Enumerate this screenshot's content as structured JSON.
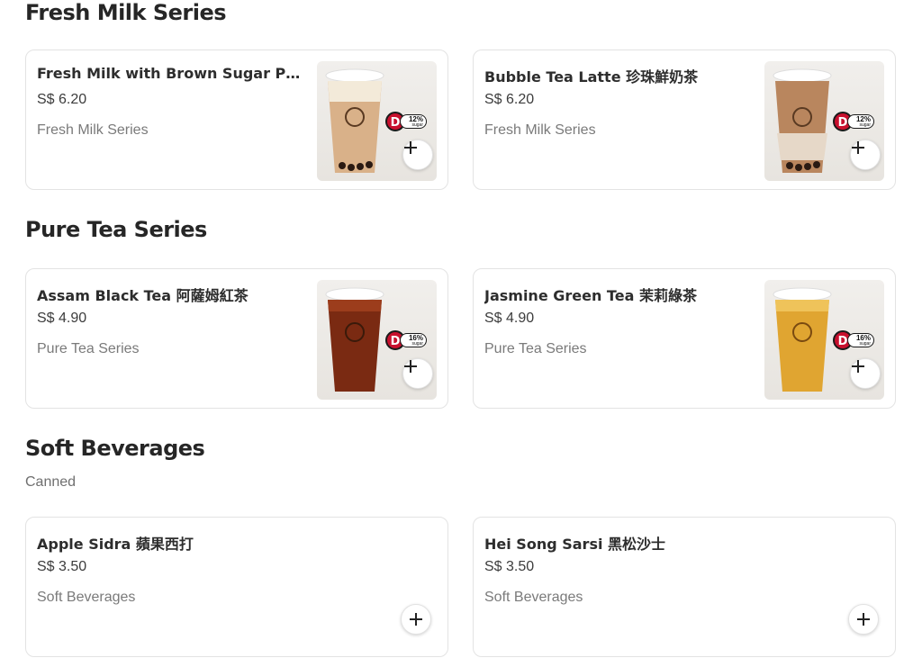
{
  "sections": [
    {
      "title": "Fresh Milk Series",
      "items": [
        {
          "name": "Fresh Milk with Brown Sugar Pearl ...",
          "price": "S$ 6.20",
          "category": "Fresh Milk Series",
          "sugar": "12%",
          "sugar_unit": "sugar",
          "grade": "D",
          "drink_color": "#d9b189",
          "top_color": "#f3ead9"
        },
        {
          "name": "Bubble Tea Latte 珍珠鮮奶茶",
          "price": "S$ 6.20",
          "category": "Fresh Milk Series",
          "sugar": "12%",
          "sugar_unit": "sugar",
          "grade": "D",
          "drink_color": "#b9865e",
          "top_color": "#e6d8c8"
        }
      ]
    },
    {
      "title": "Pure Tea Series",
      "items": [
        {
          "name": "Assam Black Tea 阿薩姆紅茶",
          "price": "S$ 4.90",
          "category": "Pure Tea Series",
          "sugar": "16%",
          "sugar_unit": "sugar",
          "grade": "D",
          "drink_color": "#7a2a12",
          "top_color": "#9c3d1c"
        },
        {
          "name": "Jasmine Green Tea 茉莉綠茶",
          "price": "S$ 4.90",
          "category": "Pure Tea Series",
          "sugar": "16%",
          "sugar_unit": "sugar",
          "grade": "D",
          "drink_color": "#e0a531",
          "top_color": "#efc35a"
        }
      ]
    },
    {
      "title": "Soft Beverages",
      "subtitle": "Canned",
      "items": [
        {
          "name": "Apple Sidra 蘋果西打",
          "price": "S$ 3.50",
          "category": "Soft Beverages"
        },
        {
          "name": "Hei Song Sarsi 黑松沙士",
          "price": "S$ 3.50",
          "category": "Soft Beverages"
        }
      ]
    }
  ],
  "icons": {
    "add": "plus-icon",
    "cup": "drink-cup-icon"
  },
  "colors": {
    "badge_red": "#c8102e"
  }
}
